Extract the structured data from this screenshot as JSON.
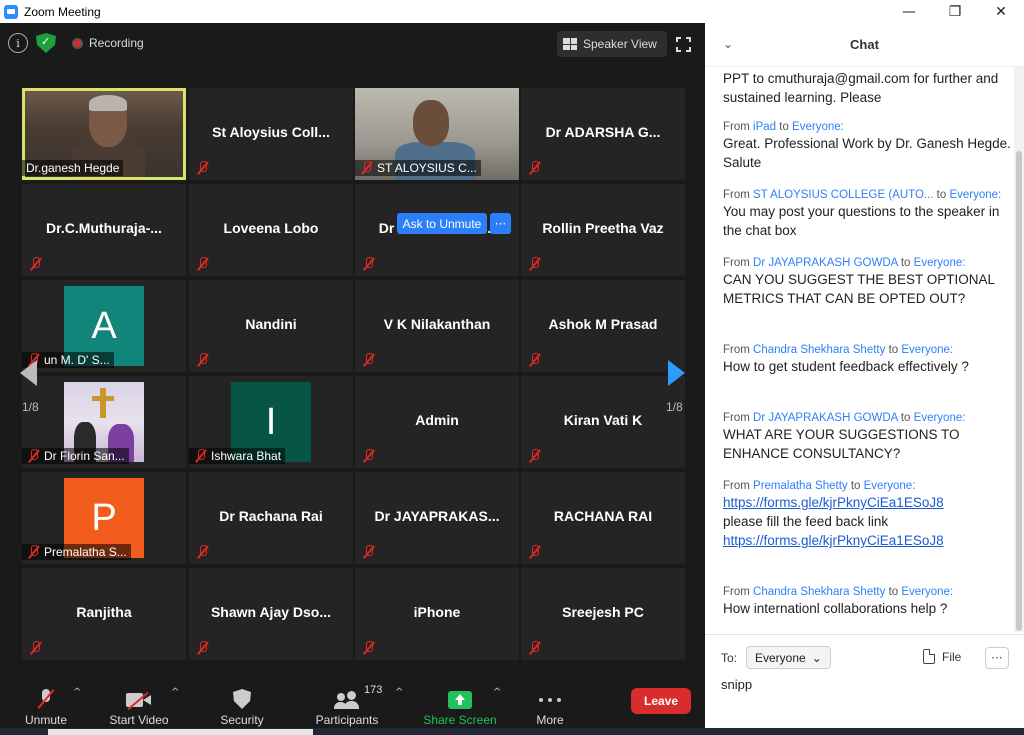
{
  "window": {
    "title": "Zoom Meeting",
    "controls": [
      "—",
      "❐",
      "✕"
    ]
  },
  "top_bar": {
    "info_glyph": "i",
    "recording_label": "Recording",
    "speaker_view_label": "Speaker View"
  },
  "tiles": [
    {
      "name": "Dr.ganesh Hegde",
      "kind": "video-ganesh"
    },
    {
      "name": "St Aloysius Coll...",
      "kind": "name"
    },
    {
      "name": "ST ALOYSIUS C...",
      "kind": "video-aloysius"
    },
    {
      "name": "Dr ADARSHA G...",
      "kind": "name"
    },
    {
      "name": "Dr.C.Muthuraja-...",
      "kind": "name"
    },
    {
      "name": "Loveena Lobo",
      "kind": "name"
    },
    {
      "name": "Dr  Vishwanatha...",
      "kind": "name"
    },
    {
      "name": "Rollin Preetha Vaz",
      "kind": "name"
    },
    {
      "name": "un M. D' S...",
      "kind": "avatar",
      "letter": "A",
      "color": "#11857a"
    },
    {
      "name": "Nandini",
      "kind": "name"
    },
    {
      "name": "V K Nilakanthan",
      "kind": "name"
    },
    {
      "name": "Ashok M Prasad",
      "kind": "name"
    },
    {
      "name": "Dr Florin San...",
      "kind": "photo-florin"
    },
    {
      "name": "Ishwara Bhat",
      "kind": "avatar",
      "letter": "I",
      "color": "#075545"
    },
    {
      "name": "Admin",
      "kind": "name"
    },
    {
      "name": "Kiran Vati K",
      "kind": "name"
    },
    {
      "name": "Premalatha S...",
      "kind": "avatar",
      "letter": "P",
      "color": "#f25c1c"
    },
    {
      "name": "Dr Rachana Rai",
      "kind": "name"
    },
    {
      "name": "Dr JAYAPRAKAS...",
      "kind": "name"
    },
    {
      "name": "RACHANA RAI",
      "kind": "name"
    },
    {
      "name": "Ranjitha",
      "kind": "name"
    },
    {
      "name": "Shawn  Ajay  Dso...",
      "kind": "name"
    },
    {
      "name": "iPhone",
      "kind": "name"
    },
    {
      "name": "Sreejesh PC",
      "kind": "name"
    }
  ],
  "ask_unmute": {
    "label": "Ask to Unmute",
    "more": "···"
  },
  "pagination": {
    "left_page": "1/8",
    "right_page": "1/8"
  },
  "toolbar": {
    "unmute": "Unmute",
    "start_video": "Start Video",
    "security": "Security",
    "participants": "Participants",
    "participant_count": "173",
    "share_screen": "Share Screen",
    "more": "More",
    "leave": "Leave",
    "caret": "^"
  },
  "chat": {
    "title": "Chat",
    "collapse_glyph": "⌄",
    "messages": [
      {
        "from": "",
        "prep": "",
        "to": "",
        "lines": [
          "PPT to cmuthuraja@gmail.com for further and sustained learning. Please"
        ]
      },
      {
        "from": "iPad",
        "prep": "From ",
        "sep": " to ",
        "to": "Everyone:",
        "lines": [
          "Great. Professional Work by Dr. Ganesh Hegde. Salute"
        ]
      },
      {
        "from": "ST ALOYSIUS COLLEGE (AUTO...",
        "prep": "From ",
        "sep": "  to ",
        "to": "Everyone:",
        "lines": [
          "You may post your questions to the speaker in the chat box"
        ]
      },
      {
        "from": "Dr JAYAPRAKASH GOWDA",
        "prep": "From ",
        "sep": " to ",
        "to": "Everyone:",
        "lines": [
          "CAN YOU SUGGEST  THE BEST OPTIONAL METRICS THAT CAN BE OPTED OUT?"
        ]
      },
      {
        "from": "Chandra Shekhara Shetty",
        "prep": "From ",
        "sep": " to ",
        "to": "Everyone:",
        "lines": [
          "How to get student feedback effectively ?"
        ]
      },
      {
        "from": "Dr JAYAPRAKASH GOWDA",
        "prep": "From ",
        "sep": " to ",
        "to": "Everyone:",
        "lines": [
          "WHAT ARE YOUR SUGGESTIONS TO ENHANCE CONSULTANCY?"
        ]
      },
      {
        "from": "Premalatha Shetty",
        "prep": "From ",
        "sep": " to ",
        "to": "Everyone:",
        "link1": "https://forms.gle/kjrPknyCiEa1ESoJ8",
        "text": "please fill the feed back link",
        "link2": "https://forms.gle/kjrPknyCiEa1ESoJ8"
      },
      {
        "from": "Chandra Shekhara Shetty",
        "prep": "From ",
        "sep": " to ",
        "to": "Everyone:",
        "lines": [
          "How internationl collaborations help ?"
        ]
      }
    ],
    "to_label": "To:",
    "to_value": "Everyone",
    "to_caret": "⌄",
    "file_label": "File",
    "more_glyph": "···",
    "input_value": "snipp"
  }
}
